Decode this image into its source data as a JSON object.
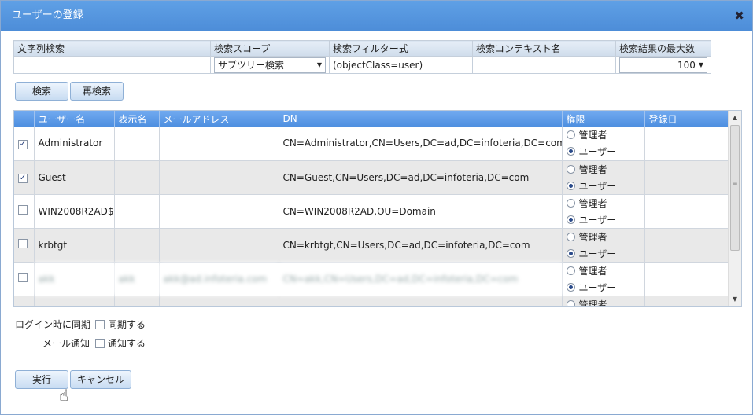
{
  "dialog": {
    "title": "ユーザーの登録",
    "close_glyph": "✖"
  },
  "search": {
    "headers": [
      "文字列検索",
      "検索スコープ",
      "検索フィルター式",
      "検索コンテキスト名",
      "検索結果の最大数"
    ],
    "string_value": "",
    "scope_value": "サブツリー検索",
    "filter_value": "(objectClass=user)",
    "context_value": "",
    "max_results_value": "100"
  },
  "buttons": {
    "search": "検索",
    "research": "再検索",
    "execute": "実行",
    "cancel": "キャンセル"
  },
  "grid": {
    "headers": [
      "",
      "ユーザー名",
      "表示名",
      "メールアドレス",
      "DN",
      "権限",
      "登録日"
    ],
    "role_admin": "管理者",
    "role_user": "ユーザー",
    "rows": [
      {
        "checked": true,
        "username": "Administrator",
        "display": "",
        "email": "",
        "dn": "CN=Administrator,CN=Users,DC=ad,DC=infoteria,DC=com",
        "role": "user",
        "date": ""
      },
      {
        "checked": true,
        "username": "Guest",
        "display": "",
        "email": "",
        "dn": "CN=Guest,CN=Users,DC=ad,DC=infoteria,DC=com",
        "role": "user",
        "date": ""
      },
      {
        "checked": false,
        "username": "WIN2008R2AD$",
        "display": "",
        "email": "",
        "dn": "CN=WIN2008R2AD,OU=Domain",
        "role": "user",
        "date": ""
      },
      {
        "checked": false,
        "username": "krbtgt",
        "display": "",
        "email": "",
        "dn": "CN=krbtgt,CN=Users,DC=ad,DC=infoteria,DC=com",
        "role": "user",
        "date": ""
      },
      {
        "checked": false,
        "username": "akk",
        "display": "akk",
        "email": "akk@ad.infoteria.com",
        "dn": "CN=akk,CN=Users,DC=ad,DC=infoteria,DC=com",
        "role": "user",
        "date": ""
      }
    ]
  },
  "options": {
    "sync_label": "ログイン時に同期",
    "sync_check": "同期する",
    "notify_label": "メール通知",
    "notify_check": "通知する"
  }
}
